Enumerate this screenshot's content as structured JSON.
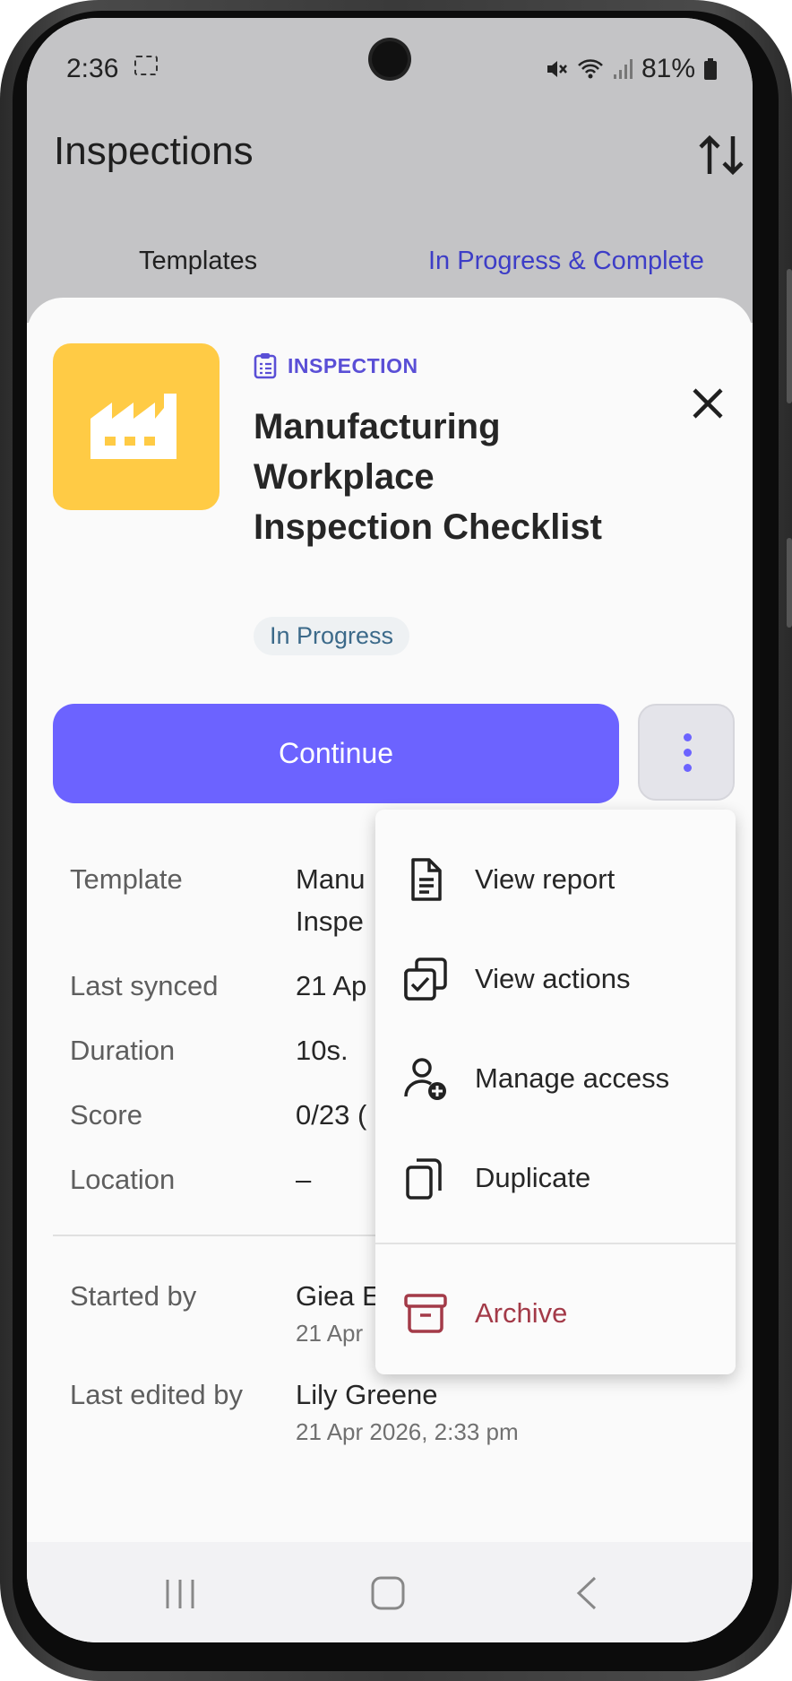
{
  "status_bar": {
    "time": "2:36",
    "battery": "81%"
  },
  "app_bar": {
    "title": "Inspections"
  },
  "tabs": {
    "templates": "Templates",
    "in_progress": "In Progress & Complete"
  },
  "sheet": {
    "type_label": "INSPECTION",
    "title": "Manufacturing Workplace Inspection Checklist",
    "status": "In Progress",
    "continue_label": "Continue"
  },
  "details": {
    "template_label": "Template",
    "template_value_line1": "Manu",
    "template_value_line2": "Inspe",
    "last_synced_label": "Last synced",
    "last_synced_value": "21 Ap",
    "duration_label": "Duration",
    "duration_value": "10s.",
    "score_label": "Score",
    "score_value": "0/23 (",
    "location_label": "Location",
    "location_value": "–",
    "started_by_label": "Started by",
    "started_by_value": "Giea E",
    "started_by_date": "21 Apr",
    "last_edited_label": "Last edited by",
    "last_edited_value": "Lily Greene",
    "last_edited_date": "21 Apr 2026, 2:33 pm"
  },
  "menu": {
    "items": [
      {
        "label": "View report",
        "icon": "document-icon"
      },
      {
        "label": "View actions",
        "icon": "actions-icon"
      },
      {
        "label": "Manage access",
        "icon": "person-add-icon"
      },
      {
        "label": "Duplicate",
        "icon": "copy-icon"
      },
      {
        "label": "Archive",
        "icon": "archive-icon"
      }
    ]
  },
  "colors": {
    "accent": "#6c63ff",
    "danger": "#a33a48",
    "thumb": "#ffcb45"
  }
}
